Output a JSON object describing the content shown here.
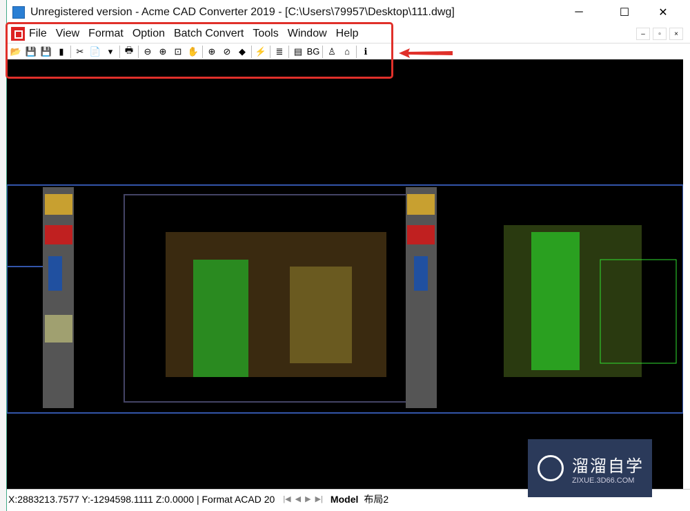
{
  "window": {
    "title": "Unregistered version - Acme CAD Converter 2019 - [C:\\Users\\79957\\Desktop\\111.dwg]",
    "controls": {
      "minimize": "─",
      "maximize": "☐",
      "close": "✕"
    },
    "mdi_controls": {
      "minimize": "–",
      "restore": "▫",
      "close": "×"
    }
  },
  "menu": [
    "File",
    "View",
    "Format",
    "Option",
    "Batch Convert",
    "Tools",
    "Window",
    "Help"
  ],
  "toolbar": [
    {
      "icon": "open-icon",
      "glyph": "📂"
    },
    {
      "icon": "save-icon",
      "glyph": "💾"
    },
    {
      "icon": "save-as-icon",
      "glyph": "💾"
    },
    {
      "icon": "export-icon",
      "glyph": "▮"
    },
    "sep",
    {
      "icon": "pdf-icon",
      "glyph": "✂"
    },
    {
      "icon": "page-icon",
      "glyph": "📄"
    },
    {
      "icon": "dropdown-icon",
      "glyph": "▾"
    },
    "sep",
    {
      "icon": "print-icon",
      "glyph": "🖶"
    },
    "sep",
    {
      "icon": "zoom-out-icon",
      "glyph": "⊖"
    },
    {
      "icon": "zoom-in-icon",
      "glyph": "⊕"
    },
    {
      "icon": "zoom-window-icon",
      "glyph": "⊡"
    },
    {
      "icon": "pan-icon",
      "glyph": "✋"
    },
    "sep",
    {
      "icon": "zoom-extents-icon",
      "glyph": "⊕"
    },
    {
      "icon": "zoom-realtime-icon",
      "glyph": "⊘"
    },
    {
      "icon": "view-3d-icon",
      "glyph": "◆"
    },
    "sep",
    {
      "icon": "measure-icon",
      "glyph": "⚡"
    },
    "sep",
    {
      "icon": "layers-icon",
      "glyph": "≣"
    },
    "sep",
    {
      "icon": "properties-icon",
      "glyph": "▤"
    },
    {
      "icon": "bg-icon",
      "glyph": "BG"
    },
    "sep",
    {
      "icon": "help-user-icon",
      "glyph": "♙"
    },
    {
      "icon": "home-icon",
      "glyph": "⌂"
    },
    "sep",
    {
      "icon": "info-icon",
      "glyph": "ℹ"
    }
  ],
  "status": {
    "coords": "X:2883213.7577 Y:-1294598.1111 Z:0.0000 | Format ACAD 20",
    "tabs": [
      "Model",
      "布局2"
    ]
  },
  "watermark": {
    "cn": "溜溜自学",
    "en": "ZIXUE.3D66.COM"
  },
  "colors": {
    "annotation": "#e0302a",
    "canvas": "#000000",
    "watermark": "#2b3a5a"
  }
}
